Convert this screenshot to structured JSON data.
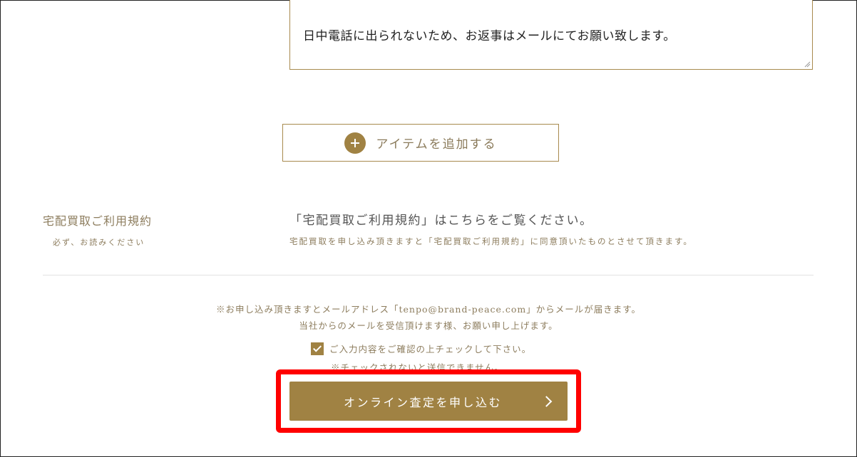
{
  "message": {
    "value": "日中電話に出られないため、お返事はメールにてお願い致します。"
  },
  "add_item": {
    "label": "アイテムを追加する"
  },
  "terms": {
    "title": "宅配買取ご利用規約",
    "subtitle": "必ず、お読みください",
    "link_text": "「宅配買取ご利用規約」はこちらをご覧ください。",
    "note": "宅配買取を申し込み頂きますと「宅配買取ご利用規約」に同意頂いたものとさせて頂きます。"
  },
  "notice": {
    "line1": "※お申し込み頂きますとメールアドレス「tenpo@brand-peace.com」からメールが届きます。",
    "line2": "当社からのメールを受信頂けます様、お願い申し上げます。"
  },
  "confirm": {
    "label": "ご入力内容をご確認の上チェックして下さい。",
    "checked": true,
    "warning": "※チェックされないと送信できません。"
  },
  "submit": {
    "label": "オンライン査定を申し込む"
  },
  "colors": {
    "accent": "#a08243",
    "highlight": "#ff0000"
  }
}
